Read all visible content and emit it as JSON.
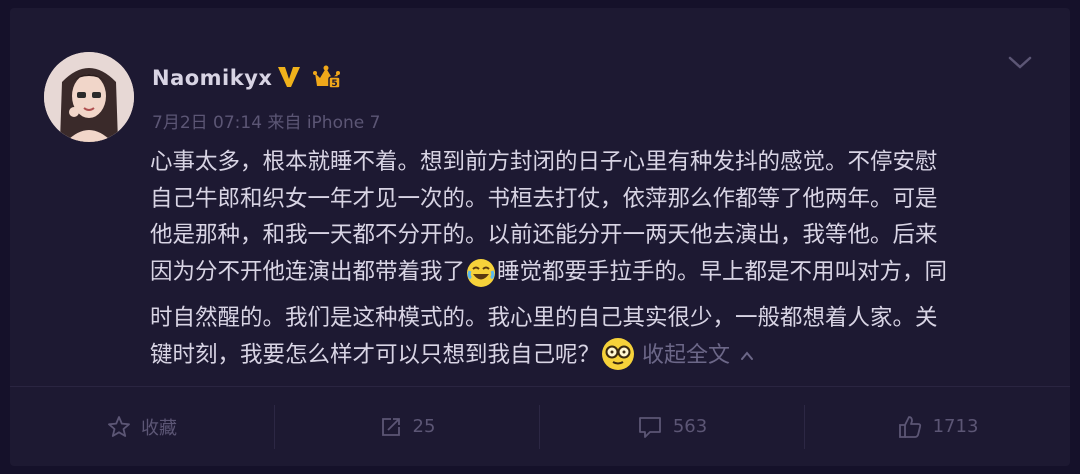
{
  "post": {
    "username": "Naomikyx",
    "meta": "7月2日 07:14 来自 iPhone 7",
    "lines": [
      "心事太多，根本就睡不着。想到前方封闭的日子心里有种发抖的感觉。不停安慰",
      "自己牛郎和织女一年才见一次的。书桓去打仗，依萍那么作都等了他两年。可是",
      "他是那种，和我一天都不分开的。以前还能分开一两天他去演出，我等他。后来"
    ],
    "line4_before": "因为分不开他连演出都带着我了",
    "line4_after": "睡觉都要手拉手的。早上都是不用叫对方，同",
    "line5": "时自然醒的。我们是这种模式的。我心里的自己其实很少，一般都想着人家。关",
    "line6": "键时刻，我要怎么样才可以只想到我自己呢？",
    "collapse_label": "收起全文"
  },
  "actions": {
    "favorite_label": "收藏",
    "repost_count": "25",
    "comment_count": "563",
    "like_count": "1713"
  },
  "colors": {
    "background": "#1d1932",
    "text": "#d8d4e4",
    "muted": "#5c5675",
    "vip": "#f0b21b",
    "emoji": "#f6d23a"
  },
  "icons": [
    "avatar",
    "verified-v-icon",
    "crown-badge-icon",
    "chevron-down-icon",
    "laugh-cry-emoji",
    "eyeglasses-emoji",
    "star-icon",
    "repost-icon",
    "comment-icon",
    "like-icon"
  ]
}
